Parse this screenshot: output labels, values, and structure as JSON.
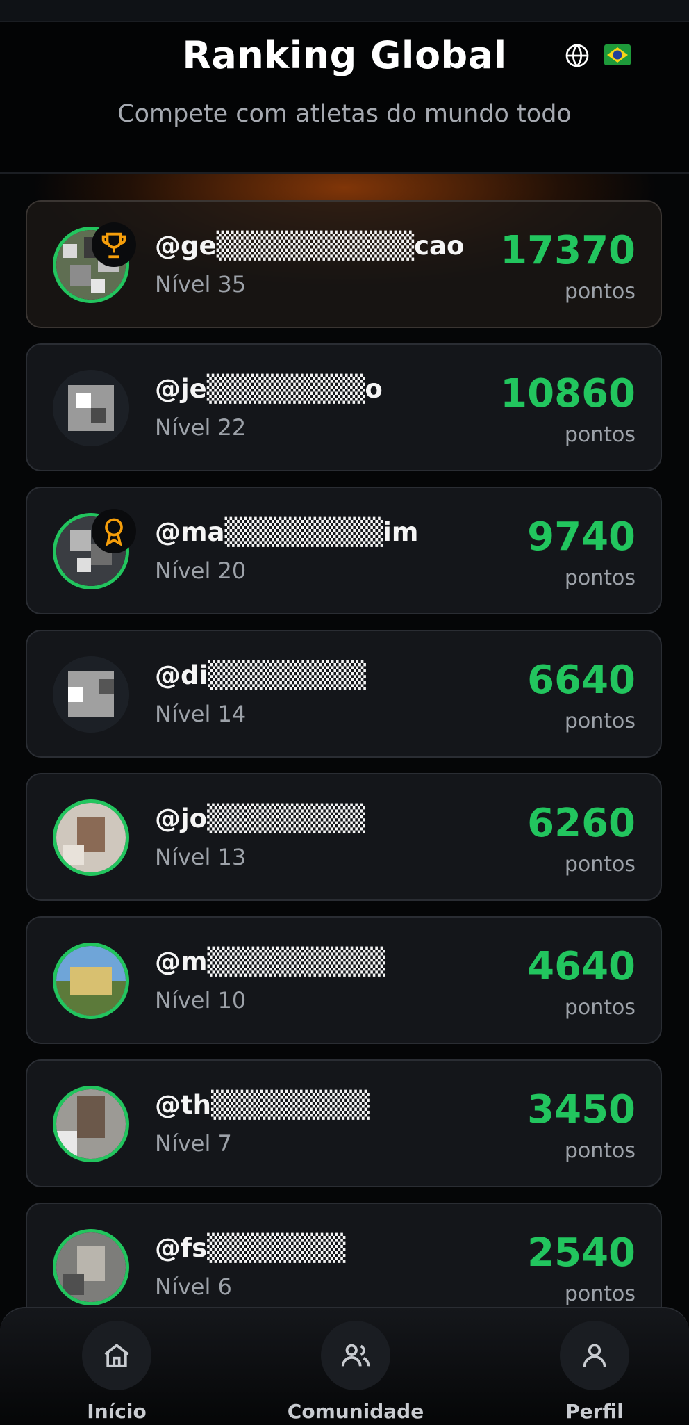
{
  "header": {
    "title": "Ranking Global",
    "subtitle": "Compete com atletas do mundo todo"
  },
  "ranking": [
    {
      "username": "@ge▒▒▒▒▒▒▒▒▒▒cao",
      "level": "Nível 35",
      "points": "17370",
      "points_label": "pontos",
      "badge": "trophy-icon"
    },
    {
      "username": "@je▒▒▒▒▒▒▒▒o",
      "level": "Nível 22",
      "points": "10860",
      "points_label": "pontos"
    },
    {
      "username": "@ma▒▒▒▒▒▒▒▒im",
      "level": "Nível 20",
      "points": "9740",
      "points_label": "pontos",
      "badge": "medal-icon"
    },
    {
      "username": "@di▒▒▒▒▒▒▒▒",
      "level": "Nível 14",
      "points": "6640",
      "points_label": "pontos"
    },
    {
      "username": "@jo▒▒▒▒▒▒▒▒",
      "level": "Nível 13",
      "points": "6260",
      "points_label": "pontos"
    },
    {
      "username": "@m▒▒▒▒▒▒▒▒▒",
      "level": "Nível 10",
      "points": "4640",
      "points_label": "pontos"
    },
    {
      "username": "@th▒▒▒▒▒▒▒▒",
      "level": "Nível 7",
      "points": "3450",
      "points_label": "pontos"
    },
    {
      "username": "@fs▒▒▒▒▒▒▒",
      "level": "Nível 6",
      "points": "2540",
      "points_label": "pontos"
    }
  ],
  "nav": {
    "home": "Início",
    "community": "Comunidade",
    "profile": "Perfil"
  },
  "colors": {
    "accent": "#22c55e",
    "badge_gold": "#f59e0b"
  }
}
